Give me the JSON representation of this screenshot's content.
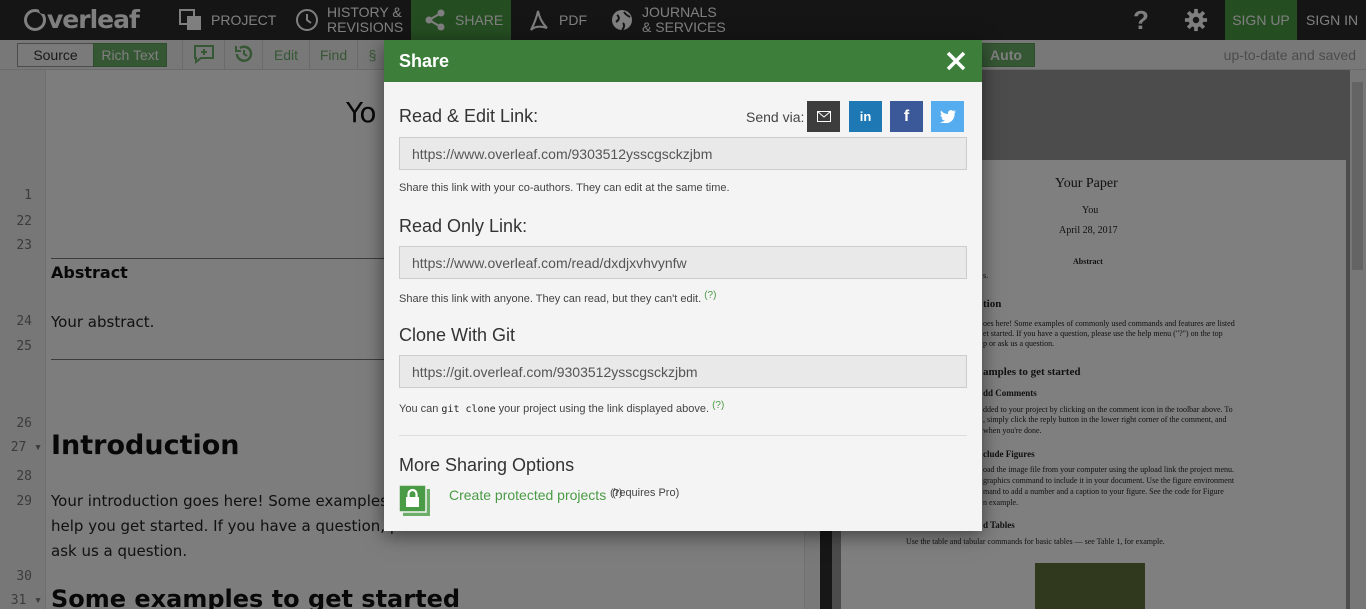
{
  "brand": {
    "name": "verleaf"
  },
  "nav": {
    "project": "PROJECT",
    "history": "HISTORY &\nREVISIONS",
    "share": "SHARE",
    "pdf": "PDF",
    "journals": "JOURNALS\n& SERVICES",
    "help": "?",
    "sign_up": "SIGN UP",
    "sign_in": "SIGN IN"
  },
  "toolbar": {
    "source": "Source",
    "rich_text": "Rich Text",
    "edit": "Edit",
    "find": "Find",
    "section": "§",
    "auto": "Auto",
    "status": "up-to-date and saved"
  },
  "editor": {
    "line_numbers": [
      {
        "n": "1"
      },
      {
        "n": "22"
      },
      {
        "n": "23"
      },
      {
        "n": "24"
      },
      {
        "n": "25"
      },
      {
        "n": "26"
      },
      {
        "n": "27 ▾"
      },
      {
        "n": "28"
      },
      {
        "n": "29"
      },
      {
        "n": "30"
      },
      {
        "n": "31 ▾"
      }
    ],
    "title_fragment": "Yo",
    "abstract_heading": "Abstract",
    "abstract_text": "Your abstract.",
    "intro_heading": "Introduction",
    "intro_lines": [
      "Your introduction goes here! Some examples of co",
      "help you get started. If you have a question, please",
      "ask us a question."
    ],
    "examples_heading": "Some examples to get started"
  },
  "pdf_preview": {
    "title": "Your Paper",
    "author": "You",
    "date": "April 28, 2017",
    "abstract_heading": "Abstract",
    "fragments": [
      "s.",
      "tion",
      "oes here! Some examples of commonly used commands and features are listed",
      "et started. If you have a question, please use the help menu (\"?\") on the top",
      "p or ask us a question.",
      "amples to get started",
      "dd Comments",
      "dded to your project by clicking on the comment icon in the toolbar above. To",
      ", simply click the reply button in the lower right corner of the comment, and",
      "when you're done.",
      "clude Figures",
      "oad the image file from your computer using the upload link the project menu.",
      "graphics command to include it in your document. Use the figure environment",
      "mand to add a number and a caption to your figure. See the code for Figure",
      "n example.",
      "d Tables",
      "Use the table and tabular commands for basic tables — see Table 1, for example."
    ]
  },
  "share_modal": {
    "title": "Share",
    "send_via": "Send via:",
    "social": [
      "email",
      "in",
      "f",
      "twitter"
    ],
    "read_edit": {
      "title": "Read & Edit Link:",
      "url": "https://www.overleaf.com/9303512ysscgsckzjbm",
      "help": "Share this link with your co-authors. They can edit at the same time."
    },
    "read_only": {
      "title": "Read Only Link:",
      "url": "https://www.overleaf.com/read/dxdjxvhvynfw",
      "help": "Share this link with anyone. They can read, but they can't edit.",
      "q": "(?)"
    },
    "clone_git": {
      "title": "Clone With Git",
      "url": "https://git.overleaf.com/9303512ysscgsckzjbm",
      "help_pre": "You can",
      "help_code": "git clone",
      "help_post": "your project using the link displayed above.",
      "q": "(?)"
    },
    "more": {
      "title": "More Sharing Options",
      "link": "Create protected projects",
      "q": "(?)",
      "requires": "(requires Pro)"
    }
  },
  "colors": {
    "accent_green": "#4a9b45",
    "modal_header": "#3d7f3a",
    "email": "#3d3d3d",
    "linkedin": "#1e78b4",
    "facebook": "#3b5998",
    "twitter": "#55acee"
  }
}
